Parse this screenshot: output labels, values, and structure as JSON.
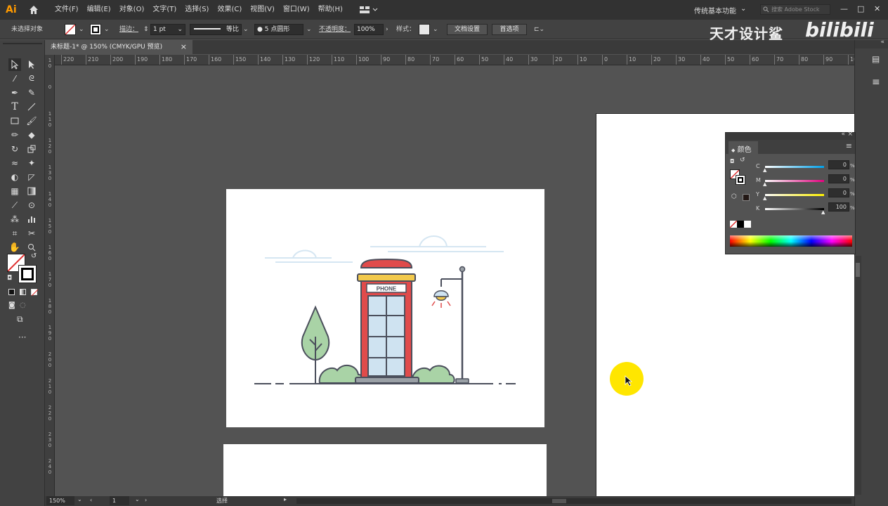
{
  "app": {
    "logo": "Ai",
    "accent": "#ff9a00"
  },
  "menu": [
    "文件(F)",
    "编辑(E)",
    "对象(O)",
    "文字(T)",
    "选择(S)",
    "效果(C)",
    "视图(V)",
    "窗口(W)",
    "帮助(H)"
  ],
  "workspace": {
    "label": "传统基本功能",
    "chevron": "⌄"
  },
  "search": {
    "placeholder": "搜索 Adobe Stock"
  },
  "window_buttons": {
    "minimize": "—",
    "maximize": "□",
    "close": "✕"
  },
  "control": {
    "selection_status": "未选择对象",
    "stroke_label": "描边：",
    "stroke_weight": "1 pt",
    "stroke_style": "等比",
    "brush": "5 点圆形",
    "opacity_label": "不透明度：",
    "opacity_value": "100%",
    "style_label": "样式：",
    "doc_setup": "文档设置",
    "preferences": "首选项"
  },
  "watermark": {
    "text": "天才设计鲨",
    "brand": "bilibili"
  },
  "document_tab": {
    "title": "未标题-1* @ 150% (CMYK/GPU 预览)",
    "close": "×"
  },
  "ruler_h": [
    "220",
    "210",
    "200",
    "190",
    "180",
    "170",
    "160",
    "150",
    "140",
    "130",
    "120",
    "110",
    "100",
    "90",
    "80",
    "70",
    "60",
    "50",
    "40",
    "30",
    "20",
    "10",
    "0",
    "10",
    "20",
    "30",
    "40",
    "50",
    "60",
    "70",
    "80",
    "90",
    "100"
  ],
  "ruler_v": [
    "1\n0",
    "0",
    "1\n1\n0",
    "1\n2\n0",
    "1\n3\n0",
    "1\n4\n0",
    "1\n5\n0",
    "1\n6\n0",
    "1\n7\n0",
    "1\n8\n0",
    "1\n9\n0",
    "2\n0\n0",
    "2\n1\n0",
    "2\n2\n0",
    "2\n3\n0",
    "2\n4\n0"
  ],
  "illustration": {
    "sign": "PHONE"
  },
  "color_panel": {
    "title": "颜色",
    "channels": [
      {
        "label": "C",
        "value": "0",
        "unit": "%"
      },
      {
        "label": "M",
        "value": "0",
        "unit": "%"
      },
      {
        "label": "Y",
        "value": "0",
        "unit": "%"
      },
      {
        "label": "K",
        "value": "100",
        "unit": "%"
      }
    ]
  },
  "status": {
    "zoom": "150%",
    "artboard": "1",
    "tool": "选择"
  },
  "colors": {
    "booth_red": "#e04b4b",
    "booth_roof": "#f2c94c",
    "glass": "#cfe3f1",
    "tree": "#a9d3a6",
    "cursor_highlight": "#ffe600"
  }
}
